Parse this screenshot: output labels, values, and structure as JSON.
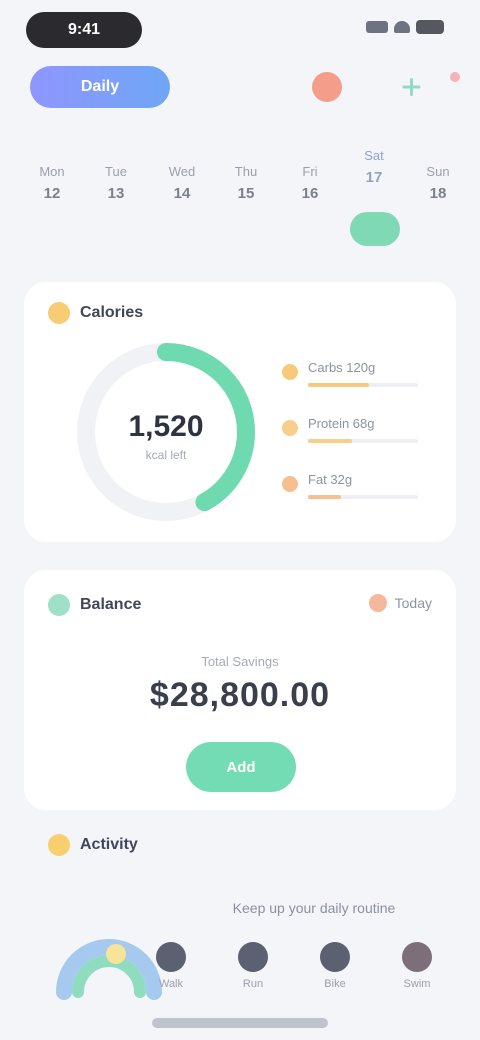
{
  "status_bar": {
    "time": "9:41"
  },
  "header": {
    "brand": "Daily",
    "colors": {
      "bell": "#f59d8b",
      "plus": "#93d9c4"
    }
  },
  "week": {
    "days": [
      {
        "name": "Mon",
        "num": "12"
      },
      {
        "name": "Tue",
        "num": "13"
      },
      {
        "name": "Wed",
        "num": "14"
      },
      {
        "name": "Thu",
        "num": "15"
      },
      {
        "name": "Fri",
        "num": "16"
      },
      {
        "name": "Sat",
        "num": "17",
        "active": true
      },
      {
        "name": "Sun",
        "num": "18"
      }
    ],
    "active_color": "#7fd9b5"
  },
  "calories": {
    "title": "Calories",
    "value": "1,520",
    "unit": "kcal left",
    "progress": 0.42,
    "ring_color": "#6fd9b0",
    "macros": [
      {
        "label": "Carbs 120g",
        "color": "#f7c97a",
        "fill": 0.55
      },
      {
        "label": "Protein 68g",
        "color": "#f8cf8a",
        "fill": 0.4
      },
      {
        "label": "Fat 32g",
        "color": "#f7be90",
        "fill": 0.3
      }
    ]
  },
  "balance": {
    "title": "Balance",
    "tag": "Today",
    "label": "Total Savings",
    "amount": "$28,800.00",
    "button": "Add",
    "accent": "#74dcb4"
  },
  "activity": {
    "title": "Activity",
    "headline": "Keep up your daily routine",
    "items": [
      {
        "label": "Walk",
        "color": "#5b6170"
      },
      {
        "label": "Run",
        "color": "#5b6170"
      },
      {
        "label": "Bike",
        "color": "#5b6170"
      },
      {
        "label": "Swim",
        "color": "#7c6f79"
      }
    ]
  }
}
